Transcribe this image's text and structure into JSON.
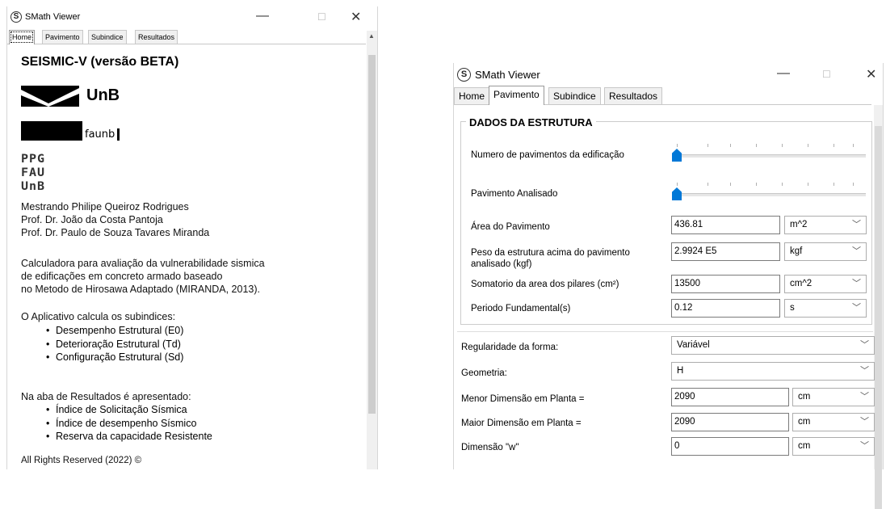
{
  "left": {
    "title": "SMath Viewer",
    "tabs": [
      "Home",
      "Pavimento",
      "Subindice",
      "Resultados"
    ],
    "heading": "SEISMIC-V (versão BETA)",
    "logo_unb": "UnB",
    "logo_faunb": "faunb",
    "logo_ppg": [
      "PPG",
      "FAU",
      "UnB"
    ],
    "authors": [
      "Mestrando Philipe Queiroz Rodrigues",
      "Prof. Dr. João da Costa Pantoja",
      "Prof. Dr. Paulo de Souza Tavares Miranda"
    ],
    "description": [
      "Calculadora para avaliação da vulnerabilidade sismica",
      "de edificações em concreto armado baseado",
      "no Metodo  de Hirosawa Adaptado (MIRANDA, 2013)."
    ],
    "subindices_intro": "O Aplicativo calcula os subindices:",
    "subindices": [
      "Desempenho Estrutural (E0)",
      "Deterioração  Estrutural (Td)",
      "Configuração  Estrutural (Sd)"
    ],
    "resultados_intro": "Na aba de Resultados é apresentado:",
    "resultados": [
      "Índice de Solicitação Sísmica",
      "Índice de desempenho Sísmico",
      "Reserva da capacidade Resistente"
    ],
    "footer": "All Rights Reserved (2022)  ©"
  },
  "right": {
    "title": "SMath Viewer",
    "tabs": [
      "Home",
      "Pavimento",
      "Subindice",
      "Resultados"
    ],
    "group_title": "DADOS DA ESTRUTURA",
    "num_pavimentos_label": "Numero de pavimentos da edificação",
    "pavimento_analisado_label": "Pavimento Analisado",
    "area_label": "Área do Pavimento",
    "area_value": "436.81",
    "area_unit": "m^2",
    "peso_label": "Peso da estrutura acima do pavimento analisado (kgf)",
    "peso_value": "2.9924 E5",
    "peso_unit": "kgf",
    "pilares_label": "Somatorio da area dos pilares (cm²)",
    "pilares_value": "13500",
    "pilares_unit": "cm^2",
    "periodo_label": "Periodo Fundamental(s)",
    "periodo_value": "0.12",
    "periodo_unit": "s",
    "regularidade_label": "Regularidade da forma:",
    "regularidade_value": "Variável",
    "geometria_label": "Geometria:",
    "geometria_value": "H",
    "menor_label": "Menor Dimensão em Planta =",
    "menor_value": "2090",
    "menor_unit": "cm",
    "maior_label": "Maior Dimensão em Planta =",
    "maior_value": "2090",
    "maior_unit": "cm",
    "w_label": "Dimensão \"w\"",
    "w_value": "0",
    "w_unit": "cm"
  },
  "icons": {
    "app": "smath-icon",
    "minimize": "minimize-icon",
    "maximize": "maximize-icon",
    "close": "close-icon",
    "dropdown": "chevron-down-icon"
  }
}
